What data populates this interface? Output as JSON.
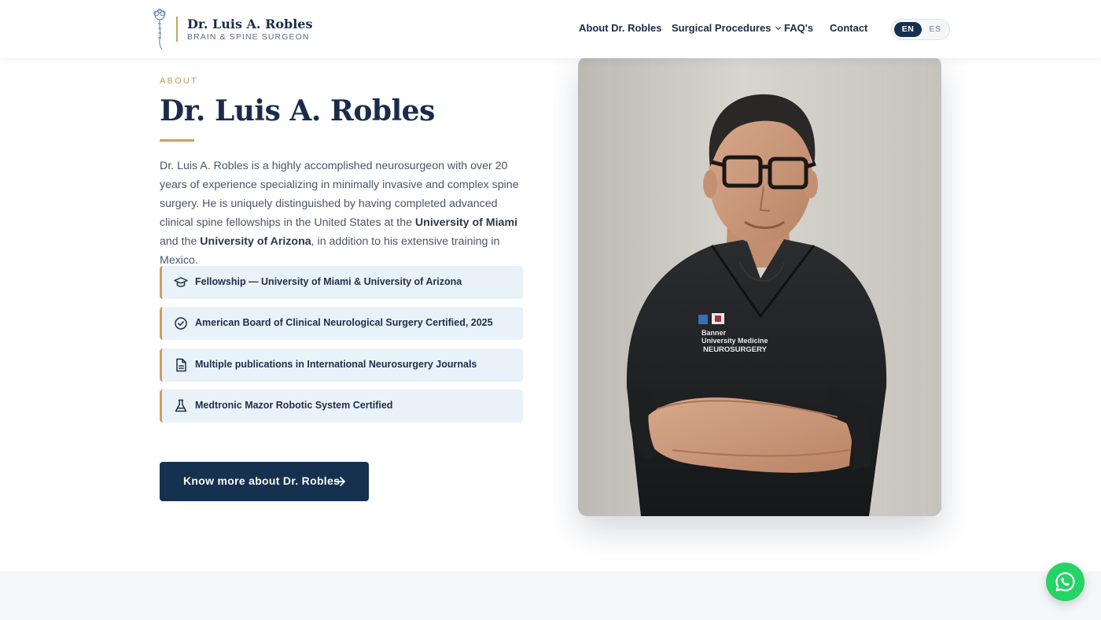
{
  "header": {
    "logo": {
      "name": "Dr. Luis A. Robles",
      "tagline": "BRAIN & SPINE SURGEON",
      "icon": "spine-brain-logo-icon"
    },
    "nav": {
      "about": "About Dr. Robles",
      "procedures": "Surgical Procedures",
      "faq": "FAQ's",
      "contact": "Contact"
    },
    "lang": {
      "active": "EN",
      "other": "ES"
    }
  },
  "about": {
    "eyebrow": "ABOUT",
    "title": "Dr. Luis A. Robles",
    "bio": {
      "part1": "Dr. Luis A. Robles is a highly accomplished neurosurgeon with over 20 years of experience specializing in minimally invasive and complex spine surgery. He is uniquely distinguished by having completed advanced clinical spine fellowships in the United States at the ",
      "miami": "University of Miami",
      "part2": " and the ",
      "arizona": "University of Arizona",
      "part3": ", in addition to his extensive training in Mexico."
    },
    "credentials": [
      {
        "icon": "graduation-cap-icon",
        "text": "Fellowship — University of Miami & University of Arizona"
      },
      {
        "icon": "check-circle-icon",
        "text": "American Board of Clinical Neurological Surgery Certified, 2025"
      },
      {
        "icon": "document-icon",
        "text": "Multiple publications in International Neurosurgery Journals"
      },
      {
        "icon": "flask-icon",
        "text": "Medtronic Mazor Robotic System Certified"
      }
    ],
    "cta": "Know more about Dr. Robles"
  },
  "photo": {
    "scrub_text": [
      "Banner",
      "University Medicine",
      "NEUROSURGERY"
    ]
  },
  "colors": {
    "navy": "#16304f",
    "gold": "#c9a063",
    "card": "#e9f1f9",
    "whatsapp": "#25d366"
  }
}
